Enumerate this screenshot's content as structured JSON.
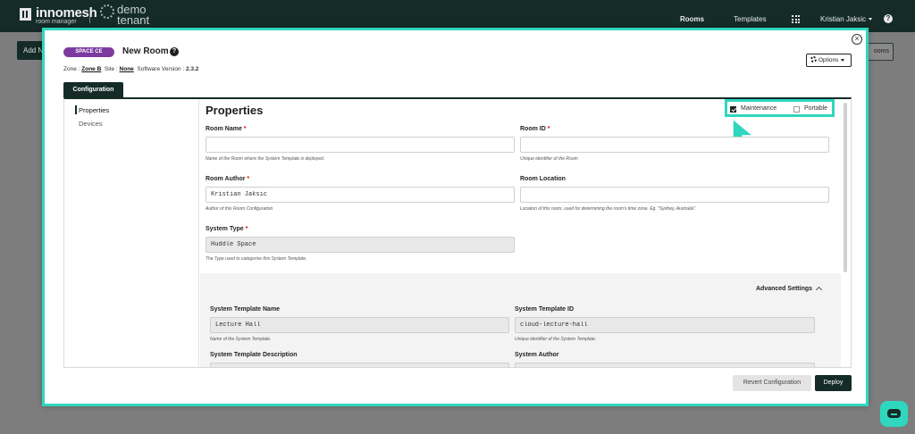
{
  "brand": {
    "name": "innomesh",
    "subtitle": "room manager",
    "tenant": "demo tenant"
  },
  "nav": {
    "rooms": "Rooms",
    "templates": "Templates",
    "user": "Kristian Jaksic"
  },
  "background": {
    "add_label": "Add N",
    "right_label": "ooms"
  },
  "modal": {
    "badge": "SPACE CE",
    "title": "New Room",
    "meta": {
      "zone_label": "Zone :",
      "zone_value": "Zone B",
      "site_label": "Site :",
      "site_value": "None",
      "version_label": "Software Version :",
      "version_value": "2.3.2"
    },
    "options_label": "Options",
    "tab_label": "Configuration",
    "side_nav": [
      "Properties",
      "Devices"
    ],
    "section_title": "Properties",
    "toggles": {
      "maintenance": {
        "label": "Maintenance",
        "checked": true
      },
      "portable": {
        "label": "Portable",
        "checked": false
      }
    },
    "fields": {
      "room_name": {
        "label": "Room Name",
        "value": "",
        "help": "Name of the Room where the System Template is deployed."
      },
      "room_id": {
        "label": "Room ID",
        "value": "",
        "help": "Unique identifier of the Room"
      },
      "room_author": {
        "label": "Room Author",
        "value": "Kristian Jaksic",
        "help": "Author of this Room Configuration"
      },
      "room_location": {
        "label": "Room Location",
        "value": "",
        "help": "Location of this room, used for determining the room's time zone. Eg. \"Sydney, Australia\"."
      },
      "system_type": {
        "label": "System Type",
        "value": "Huddle Space",
        "help": "The Type used to categorise this System Template."
      }
    },
    "advanced": {
      "title": "Advanced Settings",
      "template_name": {
        "label": "System Template Name",
        "value": "Lecture Hall",
        "help": "Name of the System Template."
      },
      "template_id": {
        "label": "System Template ID",
        "value": "cloud-lecture-hall",
        "help": "Unique identifier of the System Template."
      },
      "template_description": {
        "label": "System Template Description"
      },
      "author": {
        "label": "System Author"
      }
    },
    "buttons": {
      "revert": "Revert Configuration",
      "deploy": "Deploy"
    }
  },
  "colors": {
    "navbar": "#142b27",
    "accent": "#2fd7be",
    "badge": "#7c3aa0"
  },
  "icons": [
    "grid-icon",
    "help-icon",
    "close-icon",
    "gear-icon",
    "chevron-up-icon",
    "chat-icon",
    "cursor-icon"
  ]
}
